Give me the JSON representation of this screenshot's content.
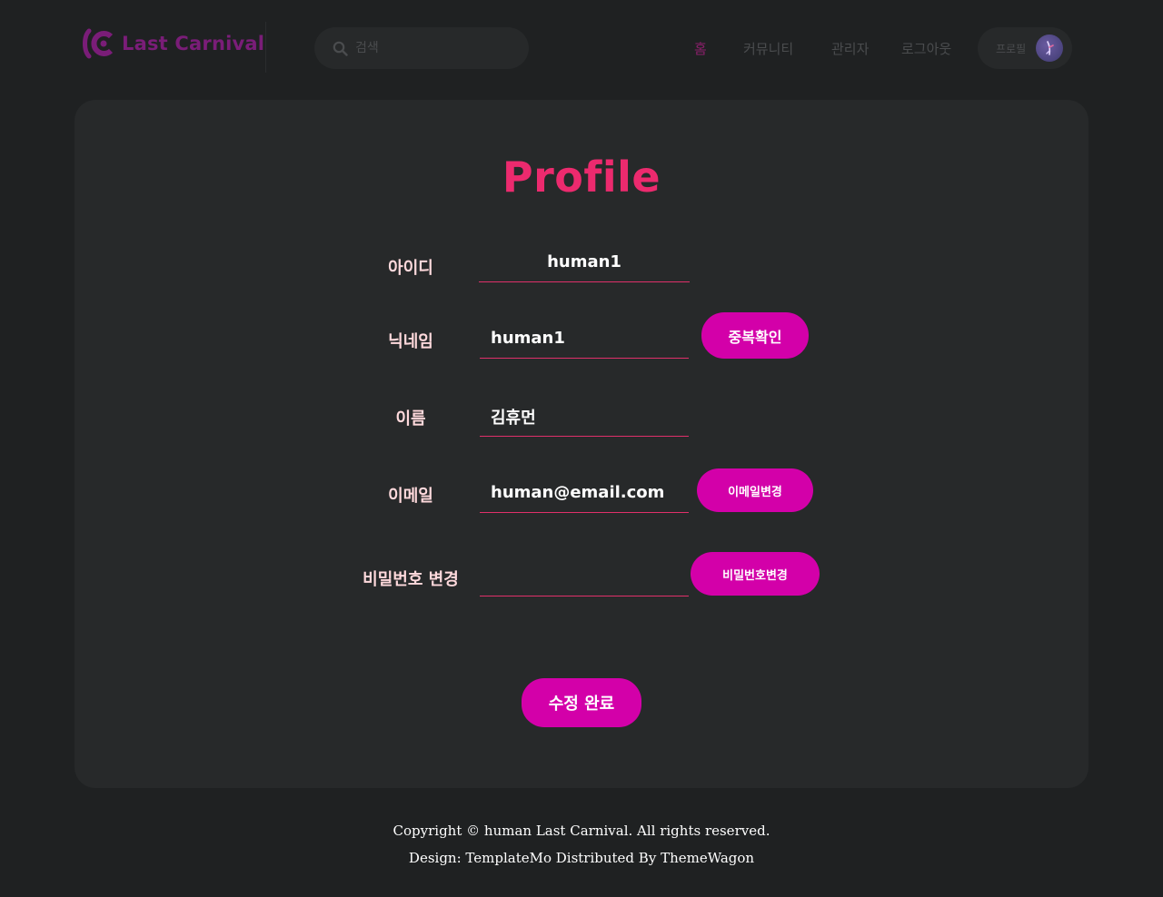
{
  "header": {
    "logo_text": "Last Carnival",
    "search_placeholder": "검색",
    "nav": [
      {
        "label": "홈",
        "active": true
      },
      {
        "label": "커뮤니티",
        "active": false
      },
      {
        "label": "관리자",
        "active": false
      },
      {
        "label": "로그아웃",
        "active": false
      }
    ],
    "profile_label": "프로필"
  },
  "profile": {
    "title": "Profile",
    "fields": {
      "id": {
        "label": "아이디",
        "value": "human1"
      },
      "nickname": {
        "label": "닉네임",
        "value": "human1",
        "button": "중복확인"
      },
      "name": {
        "label": "이름",
        "value": "김휴먼"
      },
      "email": {
        "label": "이메일",
        "value": "human@email.com",
        "button": "이메일변경"
      },
      "password": {
        "label": "비밀번호 변경",
        "value": "",
        "button": "비밀번호변경"
      }
    },
    "submit_label": "수정 완료"
  },
  "footer": {
    "copyright": "Copyright © human Last Carnival. All rights reserved.",
    "design": "Design: TemplateMo Distributed By ThemeWagon"
  },
  "colors": {
    "background": "#1f2122",
    "card": "#27292a",
    "accent": "#d300a9",
    "title": "#ec2a6e",
    "label": "#ffd9dc",
    "underline": "#e0306a",
    "logo": "#7a1d78",
    "nav_active": "#8a1f6a"
  },
  "icons": {
    "logo": "lc-logo-icon",
    "search": "search-icon",
    "avatar": "avatar-image"
  }
}
